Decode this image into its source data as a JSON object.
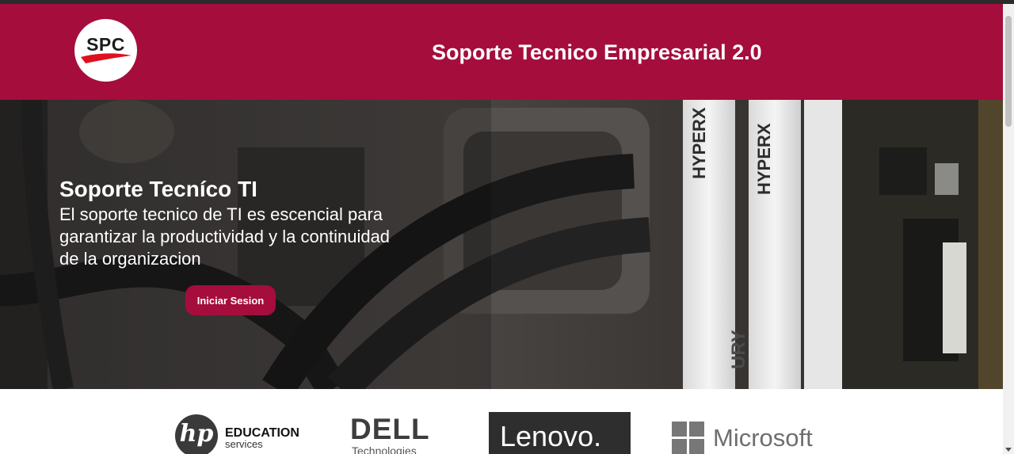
{
  "header": {
    "logo_text": "SPC",
    "title": "Soporte Tecnico Empresarial 2.0"
  },
  "hero": {
    "title": "Soporte Tecníco TI",
    "text": "El soporte tecnico de TI es escencial para garantizar la productividad y la continuidad de la organizacion",
    "button_label": "Iniciar Sesion",
    "ram_label": "HYPERX",
    "ram_label_2": "URY"
  },
  "brands": {
    "hp": {
      "mark": "hp",
      "line1": "EDUCATION",
      "line2": "services"
    },
    "dell": {
      "name": "DELL",
      "sub": "Technologies"
    },
    "lenovo": {
      "name": "Lenovo."
    },
    "microsoft": {
      "name": "Microsoft"
    }
  },
  "colors": {
    "brand": "#a50d3d",
    "white": "#ffffff"
  }
}
